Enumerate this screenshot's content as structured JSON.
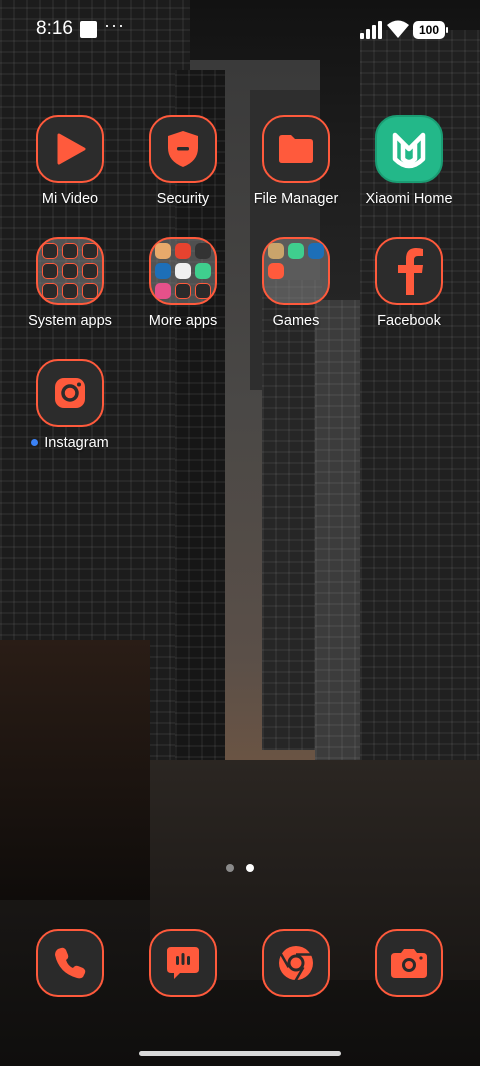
{
  "status_bar": {
    "time": "8:16",
    "menu": "···",
    "battery": "100"
  },
  "apps": [
    {
      "label": "Mi Video",
      "icon": "play-icon"
    },
    {
      "label": "Security",
      "icon": "shield-icon"
    },
    {
      "label": "File Manager",
      "icon": "folder-icon"
    },
    {
      "label": "Xiaomi Home",
      "icon": "xiaomi-home-icon"
    },
    {
      "label": "System apps",
      "icon": "folder-icon"
    },
    {
      "label": "More apps",
      "icon": "folder-icon"
    },
    {
      "label": "Games",
      "icon": "folder-icon"
    },
    {
      "label": "Facebook",
      "icon": "facebook-icon"
    },
    {
      "label": "Instagram",
      "icon": "instagram-icon",
      "new_dot": true
    }
  ],
  "page_indicator": {
    "pages": 2,
    "current": 2
  },
  "dock": [
    {
      "icon": "phone-icon"
    },
    {
      "icon": "messages-icon"
    },
    {
      "icon": "chrome-icon"
    },
    {
      "icon": "camera-icon"
    }
  ],
  "colors": {
    "accent": "#ff5a3c",
    "icon_bg": "#2c2c2c",
    "xiaomi_home": "#23b889",
    "notification_dot": "#3b82f6"
  }
}
